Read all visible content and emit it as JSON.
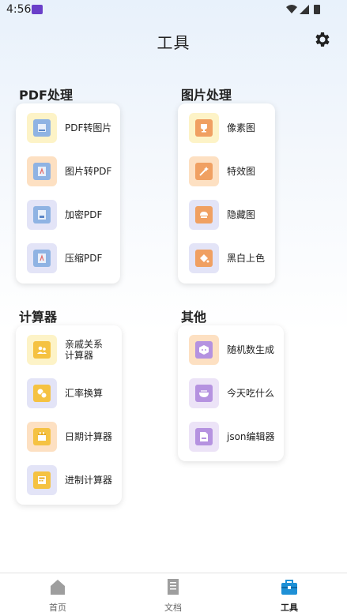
{
  "status": {
    "time": "4:56"
  },
  "header": {
    "title": "工具"
  },
  "sections": {
    "pdf": {
      "title": "PDF处理",
      "items": [
        {
          "label": "PDF转图片",
          "icon": "pdf-to-image-icon"
        },
        {
          "label": "图片转PDF",
          "icon": "image-to-pdf-icon"
        },
        {
          "label": "加密PDF",
          "icon": "encrypt-pdf-icon"
        },
        {
          "label": "压缩PDF",
          "icon": "compress-pdf-icon"
        }
      ]
    },
    "image": {
      "title": "图片处理",
      "items": [
        {
          "label": "像素图",
          "icon": "pixel-art-icon"
        },
        {
          "label": "特效图",
          "icon": "effects-icon"
        },
        {
          "label": "隐藏图",
          "icon": "hidden-image-icon"
        },
        {
          "label": "黑白上色",
          "icon": "colorize-icon"
        }
      ]
    },
    "calc": {
      "title": "计算器",
      "items": [
        {
          "label": "亲戚关系计算器",
          "line1": "亲戚关系",
          "line2": "计算器",
          "icon": "relatives-icon"
        },
        {
          "label": "汇率换算",
          "icon": "exchange-rate-icon"
        },
        {
          "label": "日期计算器",
          "icon": "date-calculator-icon"
        },
        {
          "label": "进制计算器",
          "icon": "base-converter-icon"
        }
      ]
    },
    "other": {
      "title": "其他",
      "items": [
        {
          "label": "随机数生成",
          "icon": "dice-icon"
        },
        {
          "label": "今天吃什么",
          "icon": "food-bowl-icon"
        },
        {
          "label": "json编辑器",
          "icon": "json-editor-icon"
        }
      ]
    }
  },
  "nav": {
    "home": "首页",
    "docs": "文档",
    "tools": "工具",
    "active": "tools"
  },
  "colors": {
    "active_nav": "#1e90d6",
    "icon_bg_yellow": "#fdf3c7",
    "icon_bg_peach": "#fde0c2",
    "icon_bg_lavender": "#e3e4f7",
    "icon_bg_purple": "#ece3f7"
  }
}
